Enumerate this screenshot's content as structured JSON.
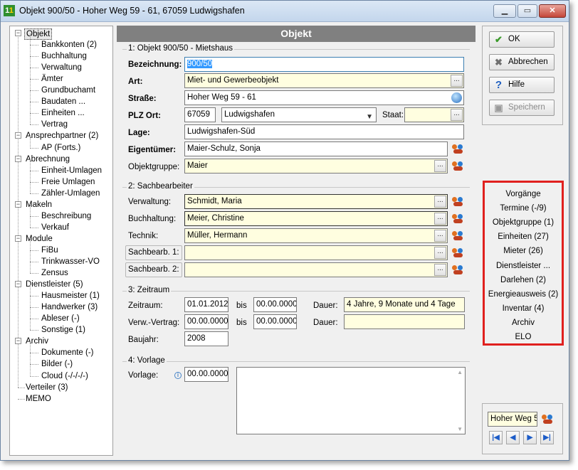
{
  "window": {
    "title": "Objekt 900/50 - Hoher Weg 59 - 61, 67059 Ludwigshafen",
    "minimize": "▁",
    "maximize": "▭",
    "close": "✕"
  },
  "tree": {
    "items": [
      {
        "label": "Objekt"
      },
      {
        "label": "Bankkonten (2)"
      },
      {
        "label": "Buchhaltung"
      },
      {
        "label": "Verwaltung"
      },
      {
        "label": "Ämter"
      },
      {
        "label": "Grundbuchamt"
      },
      {
        "label": "Baudaten ..."
      },
      {
        "label": "Einheiten ..."
      },
      {
        "label": "Vertrag"
      },
      {
        "label": "Ansprechpartner (2)"
      },
      {
        "label": "AP (Forts.)"
      },
      {
        "label": "Abrechnung"
      },
      {
        "label": "Einheit-Umlagen"
      },
      {
        "label": "Freie Umlagen"
      },
      {
        "label": "Zähler-Umlagen"
      },
      {
        "label": "Makeln"
      },
      {
        "label": "Beschreibung"
      },
      {
        "label": "Verkauf"
      },
      {
        "label": "Module"
      },
      {
        "label": "FiBu"
      },
      {
        "label": "Trinkwasser-VO"
      },
      {
        "label": "Zensus"
      },
      {
        "label": "Dienstleister (5)"
      },
      {
        "label": "Hausmeister (1)"
      },
      {
        "label": "Handwerker (3)"
      },
      {
        "label": "Ableser (-)"
      },
      {
        "label": "Sonstige (1)"
      },
      {
        "label": "Archiv"
      },
      {
        "label": "Dokumente (-)"
      },
      {
        "label": "Bilder (-)"
      },
      {
        "label": "Cloud (-/-/-/-)"
      },
      {
        "label": "Verteiler (3)"
      },
      {
        "label": "MEMO"
      }
    ],
    "expander": "−"
  },
  "main": {
    "header": "Objekt",
    "g1": {
      "title": "1: Objekt 900/50 - Mietshaus",
      "bezeichnung_label": "Bezeichnung:",
      "bezeichnung": "900/50",
      "art_label": "Art:",
      "art": "Miet- und Gewerbeobjekt",
      "strasse_label": "Straße:",
      "strasse": "Hoher Weg 59 - 61",
      "plz_label": "PLZ Ort:",
      "plz": "67059",
      "ort": "Ludwigshafen",
      "staat_label": "Staat:",
      "staat": "",
      "lage_label": "Lage:",
      "lage": "Ludwigshafen-Süd",
      "eigentuemer_label": "Eigentümer:",
      "eigentuemer": "Maier-Schulz, Sonja",
      "objektgruppe_label": "Objektgruppe:",
      "objektgruppe": "Maier"
    },
    "g2": {
      "title": "2: Sachbearbeiter",
      "verwaltung_label": "Verwaltung:",
      "verwaltung": "Schmidt, Maria",
      "buchhaltung_label": "Buchhaltung:",
      "buchhaltung": "Meier, Christine",
      "technik_label": "Technik:",
      "technik": "Müller, Hermann",
      "sb1_label": "Sachbearb. 1:",
      "sb1": "",
      "sb2_label": "Sachbearb. 2:",
      "sb2": ""
    },
    "g3": {
      "title": "3: Zeitraum",
      "zeitraum_label": "Zeitraum:",
      "zeitraum_von": "01.01.2012",
      "bis1": "bis",
      "zeitraum_bis": "00.00.0000",
      "dauer1_label": "Dauer:",
      "dauer1": "4 Jahre, 9 Monate und 4 Tage",
      "vv_label": "Verw.-Vertrag:",
      "vv_von": "00.00.0000",
      "bis2": "bis",
      "vv_bis": "00.00.0000",
      "dauer2_label": "Dauer:",
      "dauer2": "",
      "baujahr_label": "Baujahr:",
      "baujahr": "2008"
    },
    "g4": {
      "title": "4: Vorlage",
      "vorlage_label": "Vorlage:",
      "vorlage_date": "00.00.0000",
      "info": "i"
    },
    "dots": "..."
  },
  "actions": {
    "ok": "OK",
    "abbrechen": "Abbrechen",
    "hilfe": "Hilfe",
    "speichern": "Speichern"
  },
  "quicklinks": [
    "Vorgänge",
    "Termine (-/9)",
    "Objektgruppe (1)",
    "Einheiten (27)",
    "Mieter (26)",
    "Dienstleister ...",
    "Darlehen (2)",
    "Energieausweis (2)",
    "Inventar (4)",
    "Archiv",
    "ELO"
  ],
  "nav": {
    "search_value": "Hoher Weg 5",
    "first": "|◀",
    "prev": "◀",
    "next": "▶",
    "last": "▶|"
  },
  "colors": {
    "highlight": "#e0201e",
    "field_yellow": "#fffee0",
    "header_gray": "#808080"
  }
}
